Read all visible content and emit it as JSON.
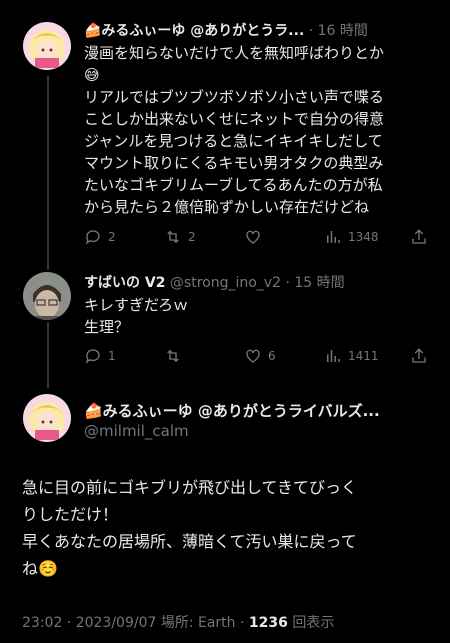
{
  "tweet1": {
    "name": "🍰みるふぃーゆ @ありがとうラ...",
    "time": "· 16 時間",
    "text_lines": [
      "漫画を知らないだけで人を無知呼ばわりとか",
      "😅",
      "リアルではブツブツボソボソ小さい声で喋る",
      "ことしか出来ないくせにネットで自分の得意",
      "ジャンルを見つけると急にイキイキしだして",
      "マウント取りにくるキモい男オタクの典型み",
      "たいなゴキブリムーブしてるあんたの方が私",
      "から見たら２億倍恥ずかしい存在だけどね"
    ],
    "replies": "2",
    "retweets": "2",
    "likes": "",
    "views": "1348"
  },
  "tweet2": {
    "name": "すばいの V2",
    "handle": "@strong_ino_v2",
    "time": "· 15 時間",
    "text_lines": [
      "キレすぎだろｗ",
      "生理？"
    ],
    "replies": "1",
    "retweets": "",
    "likes": "6",
    "views": "1411"
  },
  "main": {
    "name": "🍰みるふぃーゆ @ありがとうライバルズ...",
    "handle": "@milmil_calm",
    "more": "···",
    "text_lines": [
      "急に目の前にゴキブリが飛び出してきてびっく",
      "りしただけ！",
      "早くあなたの居場所、薄暗くて汚い巣に戻って",
      "ね☺️"
    ],
    "footer_time": "23:02 · 2023/09/07 場所: Earth · ",
    "footer_views_num": "1236",
    "footer_views_label": " 回表示"
  }
}
